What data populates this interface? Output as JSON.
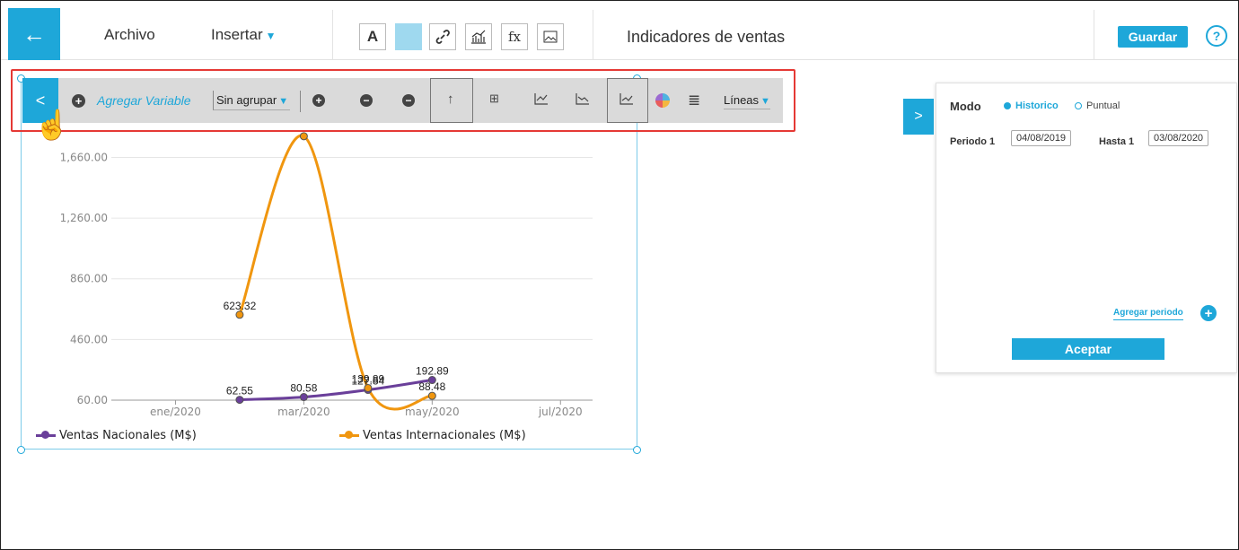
{
  "header": {
    "back_label": "←",
    "menu_file": "Archivo",
    "menu_insert": "Insertar",
    "toolbar_icons": [
      "text-icon",
      "color-fill-icon",
      "link-icon",
      "chart-icon",
      "formula-icon",
      "image-icon"
    ],
    "text_tool_label": "A",
    "formula_label": "fx",
    "title": "Indicadores de ventas",
    "save_label": "Guardar",
    "help_label": "?"
  },
  "chart_toolbar": {
    "add_variable": "Agregar Variable",
    "group_select": "Sin agrupar",
    "chart_type_select": "Líneas",
    "collapse_label": "<"
  },
  "side_panel": {
    "toggle_label": ">",
    "mode_label": "Modo",
    "mode_options": [
      "Historico",
      "Puntual"
    ],
    "mode_selected": "Historico",
    "period_label": "Periodo 1",
    "period_from": "04/08/2019",
    "until_label": "Hasta 1",
    "period_to": "03/08/2020",
    "add_period": "Agregar periodo",
    "accept": "Aceptar"
  },
  "colors": {
    "accent": "#1ea7d9",
    "series_nacionales": "#6a3f9a",
    "series_internacionales": "#f0960f",
    "highlight_outline": "#e53935"
  },
  "chart_data": {
    "type": "line",
    "y_ticks": [
      "60.00",
      "460.00",
      "860.00",
      "1,260.00",
      "1,660.00"
    ],
    "x_ticks": [
      "ene/2020",
      "mar/2020",
      "may/2020",
      "jul/2020"
    ],
    "ylim": [
      60,
      2000
    ],
    "xlim": [
      0,
      7.5
    ],
    "grid": true,
    "legend_position": "bottom",
    "series": [
      {
        "name": "Ventas Nacionales (M$)",
        "color": "#6a3f9a",
        "x": [
          2,
          3,
          4,
          5
        ],
        "values": [
          62.55,
          80.58,
          127.84,
          192.89
        ],
        "labels": [
          "62.55",
          "80.58",
          "127.84",
          "192.89"
        ]
      },
      {
        "name": "Ventas Internacionales (M$)",
        "color": "#f0960f",
        "x": [
          2,
          3,
          4,
          5
        ],
        "values": [
          623.32,
          1800,
          139.89,
          88.48
        ],
        "labels": [
          "623.32",
          "",
          "139.89",
          "88.48"
        ]
      }
    ]
  }
}
